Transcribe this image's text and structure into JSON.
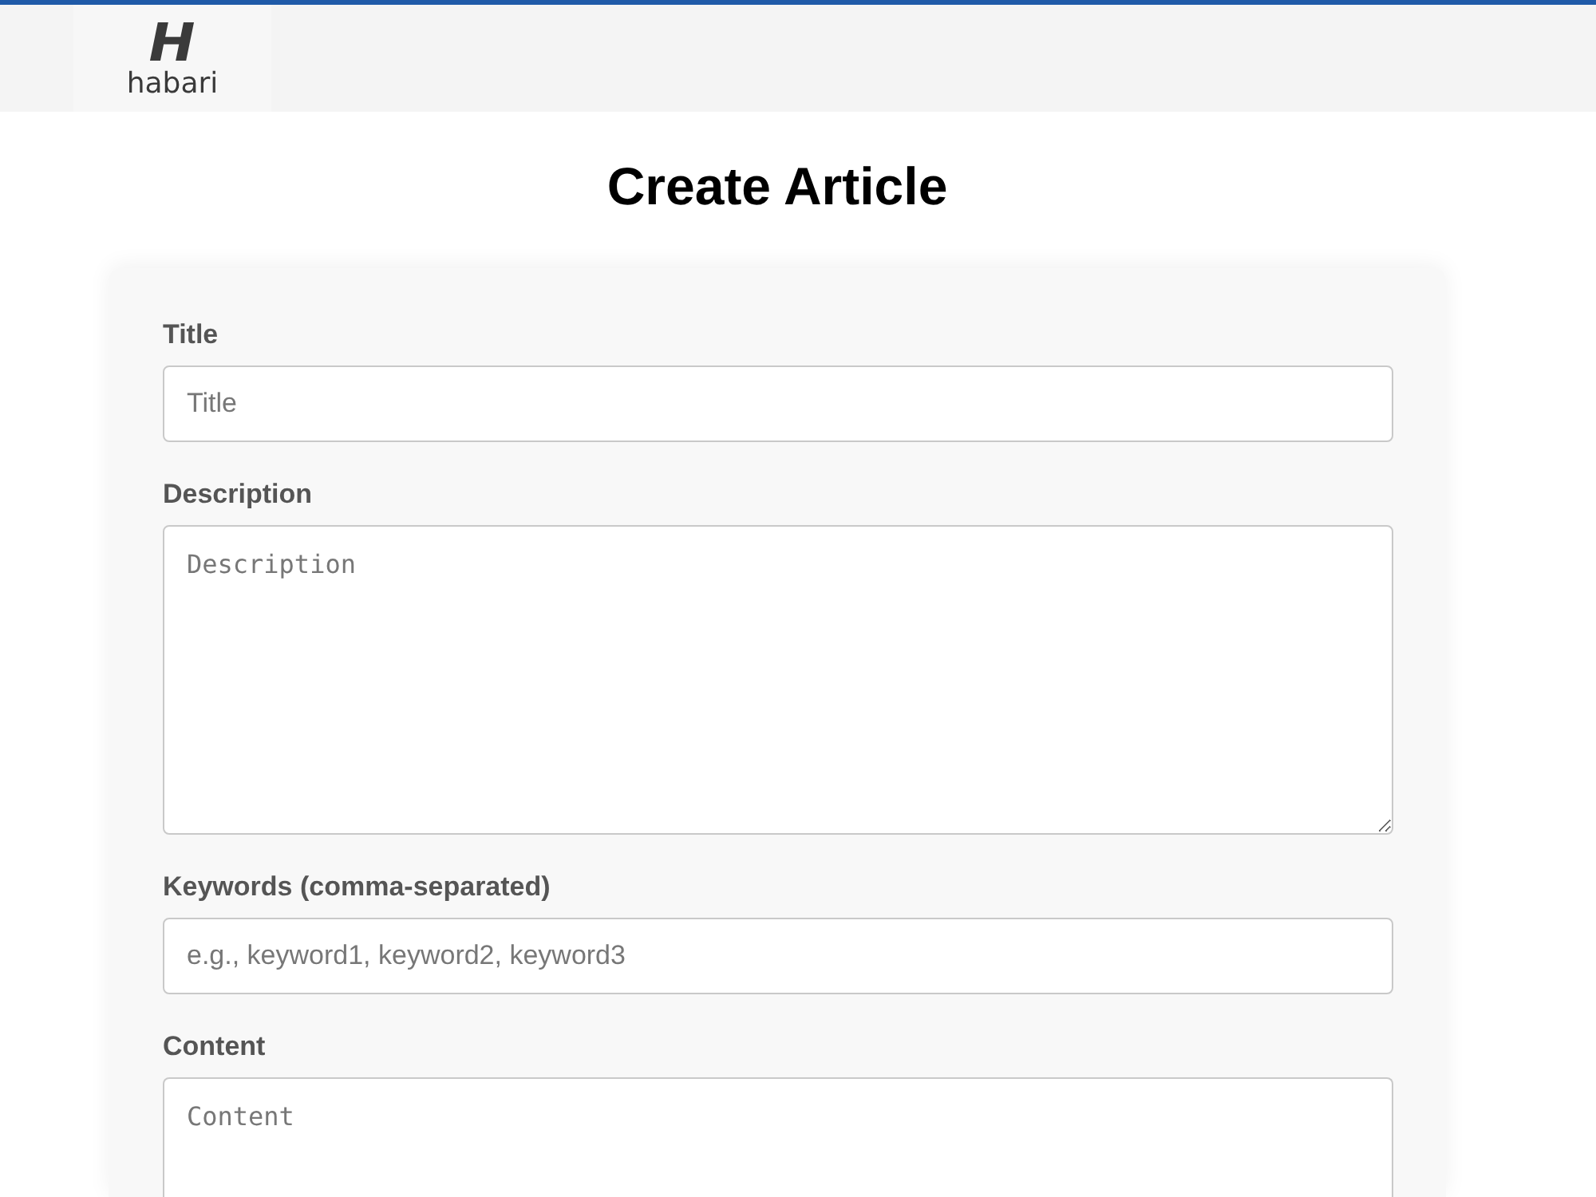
{
  "header": {
    "logo_mark": "H",
    "logo_text": "habari"
  },
  "page_title": "Create Article",
  "form": {
    "fields": [
      {
        "kind": "input",
        "label": "Title",
        "placeholder": "Title"
      },
      {
        "kind": "textarea",
        "label": "Description",
        "placeholder": "Description"
      },
      {
        "kind": "input",
        "label": "Keywords (comma-separated)",
        "placeholder": "e.g., keyword1, keyword2, keyword3"
      },
      {
        "kind": "textarea",
        "label": "Content",
        "placeholder": "Content"
      }
    ]
  }
}
